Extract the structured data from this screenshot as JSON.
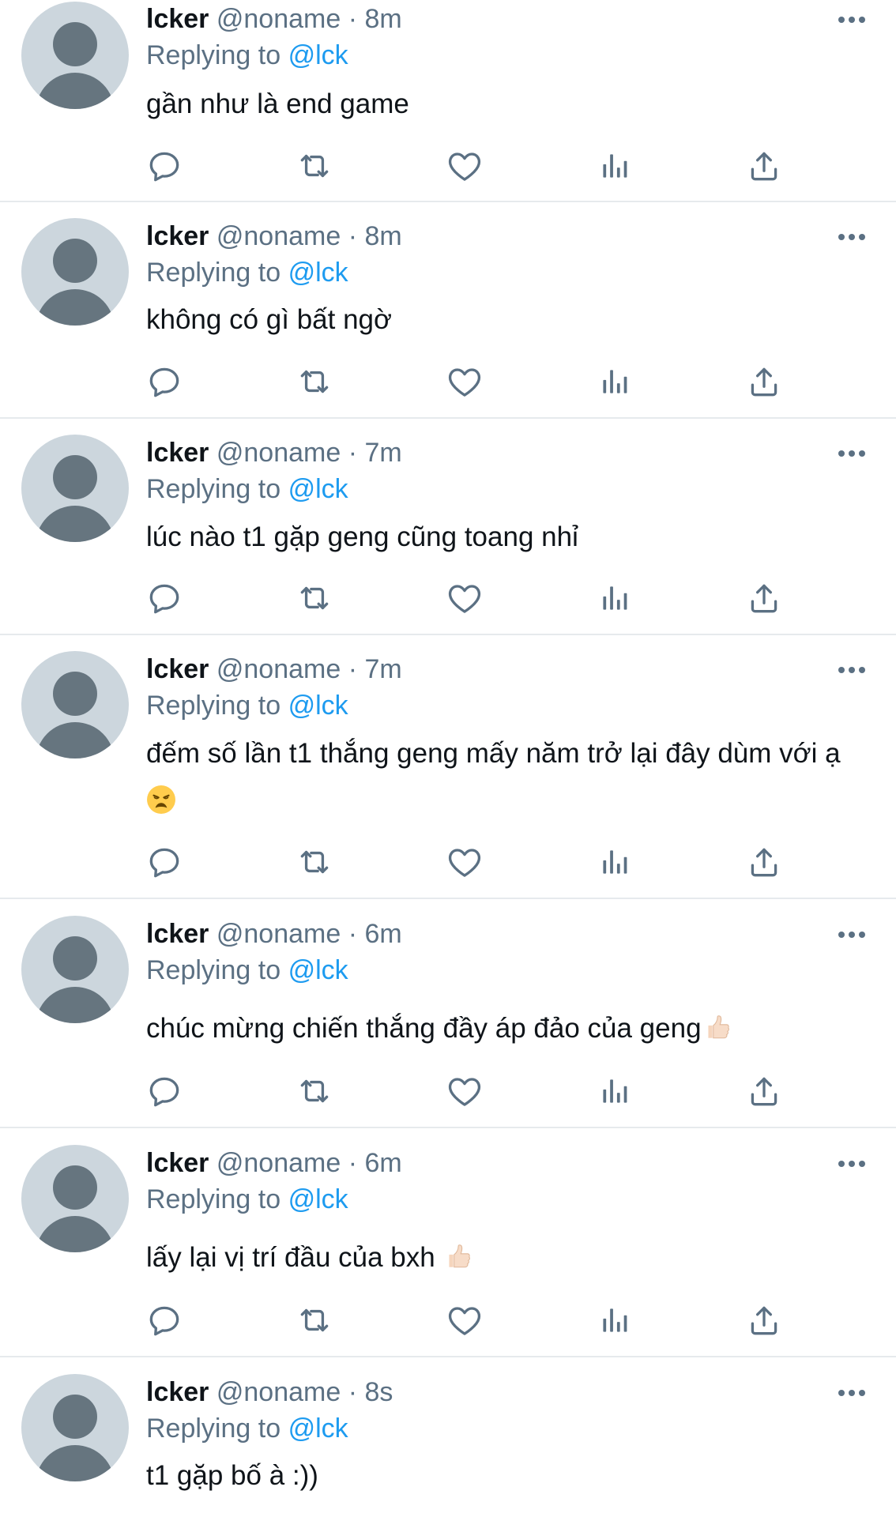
{
  "tweets": [
    {
      "name": "lcker",
      "handle": "@noname",
      "sep": "·",
      "time": "8m",
      "reply_prefix": "Replying to",
      "reply_to": "@lck",
      "text": "gần như là end game",
      "emoji": ""
    },
    {
      "name": "lcker",
      "handle": "@noname",
      "sep": "·",
      "time": "8m",
      "reply_prefix": "Replying to",
      "reply_to": "@lck",
      "text": "không có gì bất ngờ",
      "emoji": ""
    },
    {
      "name": "lcker",
      "handle": "@noname",
      "sep": "·",
      "time": "7m",
      "reply_prefix": "Replying to",
      "reply_to": "@lck",
      "text": "lúc nào t1 gặp geng cũng toang nhỉ",
      "emoji": ""
    },
    {
      "name": "lcker",
      "handle": "@noname",
      "sep": "·",
      "time": "7m",
      "reply_prefix": "Replying to",
      "reply_to": "@lck",
      "text": "đếm số lần t1 thắng geng mấy năm trở lại đây dùm với ạ",
      "emoji": "weary-face"
    },
    {
      "name": "lcker",
      "handle": "@noname",
      "sep": "·",
      "time": "6m",
      "reply_prefix": "Replying to",
      "reply_to": "@lck",
      "text": "chúc mừng chiến thắng đầy áp đảo của geng",
      "emoji": "thumbs-up"
    },
    {
      "name": "lcker",
      "handle": "@noname",
      "sep": "·",
      "time": "6m",
      "reply_prefix": "Replying to",
      "reply_to": "@lck",
      "text": "lấy lại vị trí đầu của bxh ",
      "emoji": "thumbs-up"
    },
    {
      "name": "lcker",
      "handle": "@noname",
      "sep": "·",
      "time": "8s",
      "reply_prefix": "Replying to",
      "reply_to": "@lck",
      "text": "t1 gặp bố à :))",
      "emoji": ""
    }
  ],
  "actions": [
    "reply-icon",
    "retweet-icon",
    "like-icon",
    "views-icon",
    "share-icon"
  ],
  "colors": {
    "text": "#0f1419",
    "secondary": "#5b7083",
    "link": "#1d9bf0",
    "avatar_bg": "#ccd6dd",
    "avatar_fg": "#66757f",
    "divider": "#e6eaed"
  }
}
